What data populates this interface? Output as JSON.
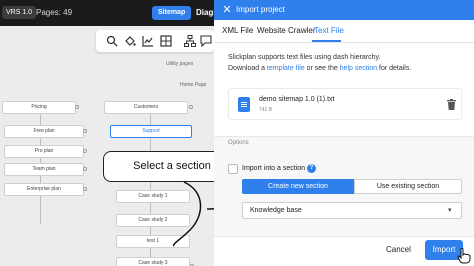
{
  "topbar": {
    "version": "VRS 1.0",
    "pages": "Pages: 49",
    "sitemap": "Sitemap",
    "diagram": "Diagr"
  },
  "toolbar": {
    "icons": [
      "search-icon",
      "fill-icon",
      "chart-icon",
      "grid-icon",
      "hierarchy-icon",
      "comment-icon"
    ]
  },
  "canvas": {
    "utility_pages": "Utility pages",
    "home_page": "Home Page",
    "nodes": {
      "pricing": "Pricing",
      "free_plan": "Free plan",
      "pro_plan": "Pro plan",
      "team_plan": "Team plan",
      "enterprise_plan": "Enterprise plan",
      "customers": "Customers",
      "support": "Support",
      "case_study_1": "Case study 1",
      "case_study_2": "Case study 2",
      "case_study_3": "Case study 3",
      "test_1": "test 1"
    }
  },
  "callout": {
    "text": "Select a section"
  },
  "modal": {
    "title": "Import project",
    "tabs": [
      "XML File",
      "Website Crawler",
      "Text File"
    ],
    "active_tab": "Text File",
    "description_line1": "Slickplan supports text files using dash hierarchy.",
    "description_line2": {
      "pre": "Download a ",
      "link1": "template file",
      "mid": " or see the ",
      "link2": "help section",
      "post": " for details."
    },
    "file": {
      "name": "demo sitemap 1.0 (1).txt",
      "size": "741 B"
    },
    "options": {
      "label": "Options",
      "import_into": "Import into a section",
      "segments": [
        "Create new section",
        "Use existing section"
      ],
      "selected_segment": "Create new section",
      "section_select": "Knowledge base"
    },
    "footer": {
      "cancel": "Cancel",
      "import": "Import"
    }
  },
  "colors": {
    "accent": "#2f80ed",
    "topbar": "#1b1b1d"
  }
}
